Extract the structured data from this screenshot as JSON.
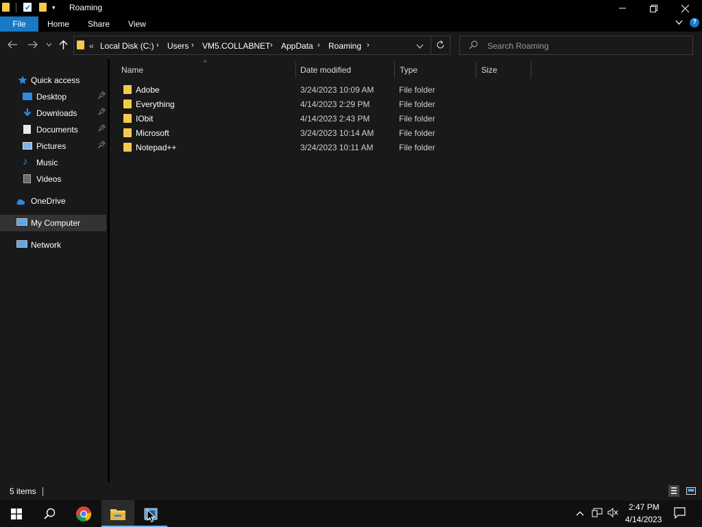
{
  "window": {
    "title": "Roaming"
  },
  "ribbon": {
    "file": "File",
    "home": "Home",
    "share": "Share",
    "view": "View"
  },
  "address": {
    "overflow": "«",
    "crumbs": [
      "Local Disk (C:)",
      "Users",
      "VM5.COLLABNET",
      "AppData",
      "Roaming"
    ]
  },
  "search": {
    "placeholder": "Search Roaming"
  },
  "navpane": {
    "quick_access": "Quick access",
    "items": [
      {
        "label": "Desktop",
        "icon": "desktop-icon",
        "pinned": true
      },
      {
        "label": "Downloads",
        "icon": "downloads-icon",
        "pinned": true
      },
      {
        "label": "Documents",
        "icon": "documents-icon",
        "pinned": true
      },
      {
        "label": "Pictures",
        "icon": "pictures-icon",
        "pinned": true
      },
      {
        "label": "Music",
        "icon": "music-icon",
        "pinned": false
      },
      {
        "label": "Videos",
        "icon": "videos-icon",
        "pinned": false
      }
    ],
    "onedrive": "OneDrive",
    "my_computer": "My Computer",
    "network": "Network"
  },
  "columns": {
    "name": "Name",
    "date": "Date modified",
    "type": "Type",
    "size": "Size"
  },
  "files": [
    {
      "name": "Adobe",
      "date": "3/24/2023 10:09 AM",
      "type": "File folder",
      "size": ""
    },
    {
      "name": "Everything",
      "date": "4/14/2023 2:29 PM",
      "type": "File folder",
      "size": ""
    },
    {
      "name": "IObit",
      "date": "4/14/2023 2:43 PM",
      "type": "File folder",
      "size": ""
    },
    {
      "name": "Microsoft",
      "date": "3/24/2023 10:14 AM",
      "type": "File folder",
      "size": ""
    },
    {
      "name": "Notepad++",
      "date": "3/24/2023 10:11 AM",
      "type": "File folder",
      "size": ""
    }
  ],
  "status": {
    "items": "5 items"
  },
  "taskbar": {
    "time": "2:47 PM",
    "date": "4/14/2023"
  },
  "colors": {
    "accent": "#1979c5",
    "folder": "#f5c94c",
    "background": "#191919"
  }
}
